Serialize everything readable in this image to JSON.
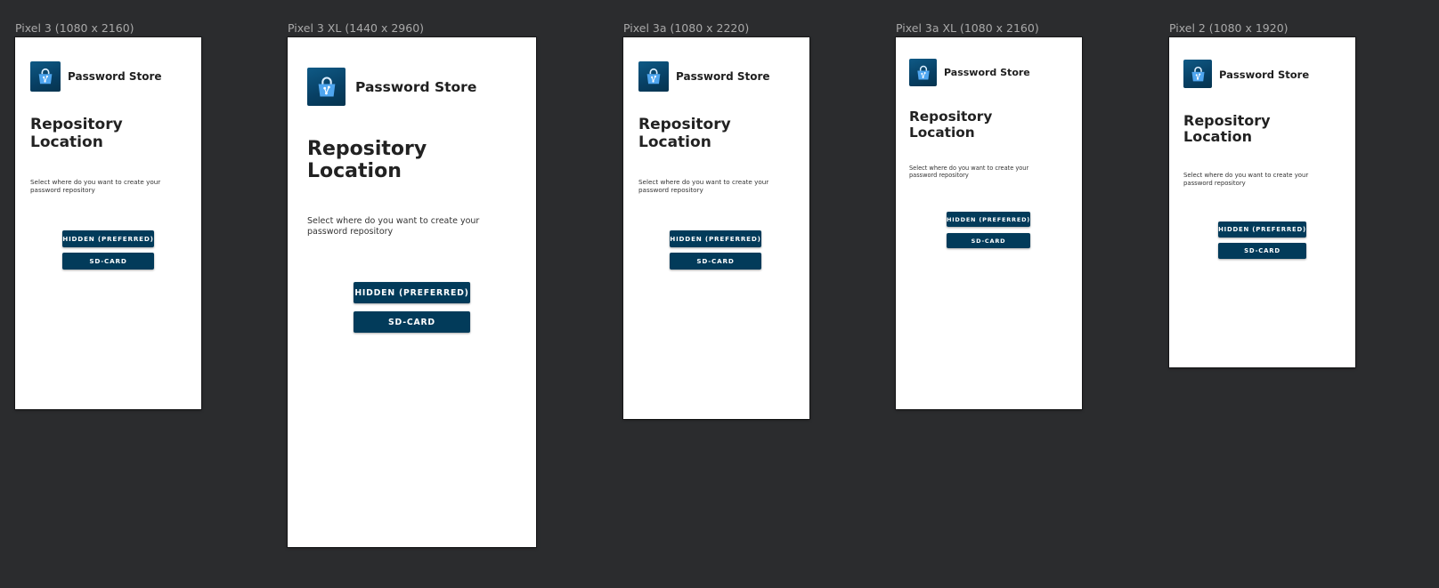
{
  "app": {
    "name": "Password Store",
    "logo_icon": "shopping-bag-git-icon",
    "accent_color": "#023b5a"
  },
  "screen": {
    "title_line1": "Repository",
    "title_line2": "Location",
    "description": "Select where do you want to create your password repository",
    "hidden_button_label": "HIDDEN (PREFERRED)",
    "sdcard_button_label": "SD-CARD"
  },
  "devices": [
    {
      "label": "Pixel 3 (1080 x 2160)"
    },
    {
      "label": "Pixel 3 XL (1440 x 2960)"
    },
    {
      "label": "Pixel 3a (1080 x 2220)"
    },
    {
      "label": "Pixel 3a XL (1080 x 2160)"
    },
    {
      "label": "Pixel 2 (1080 x 1920)"
    }
  ]
}
